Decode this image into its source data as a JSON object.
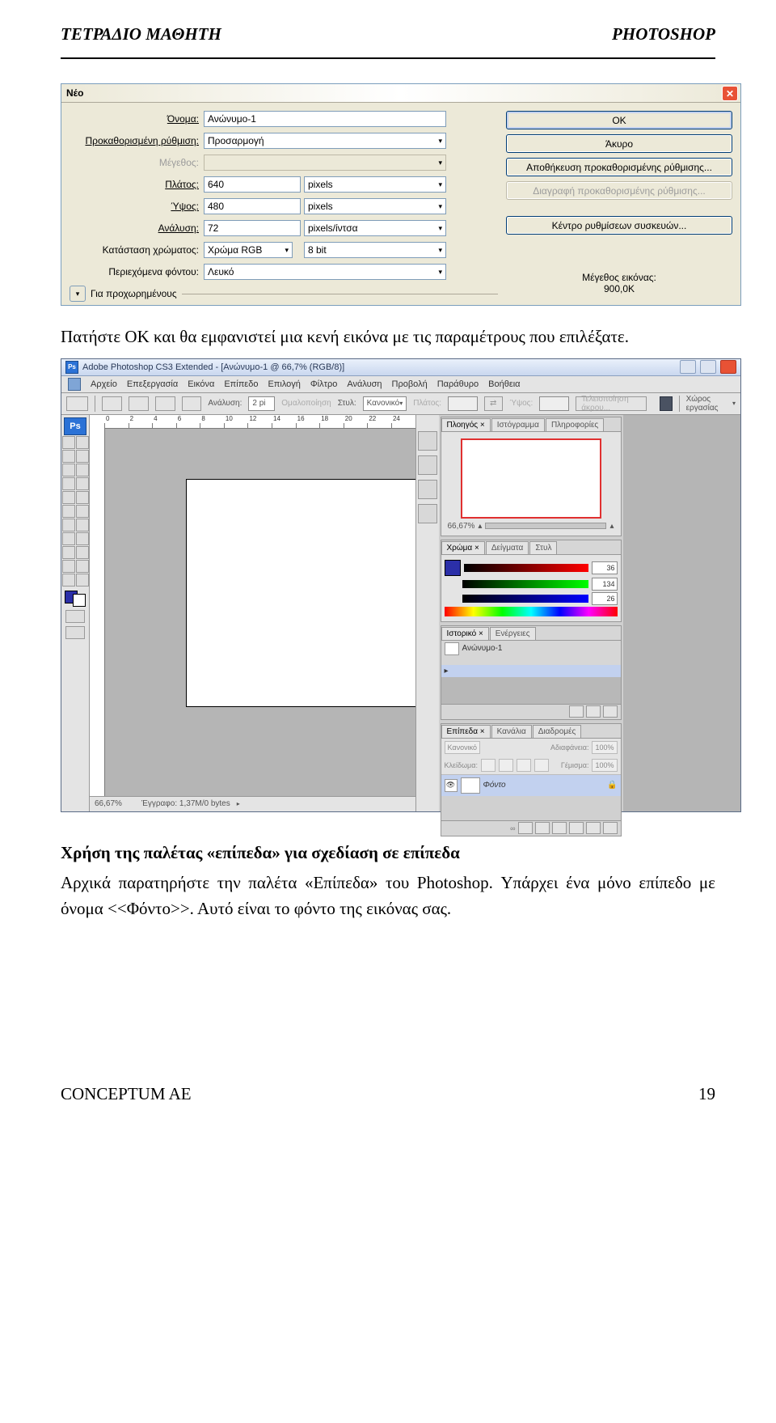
{
  "page_header": {
    "left": "ΤΕΤΡΑΔΙΟ ΜΑΘΗΤΗ",
    "right": "PHOTOSHOP"
  },
  "dialog1": {
    "title": "Νέο",
    "labels": {
      "name": "Όνομα:",
      "preset": "Προκαθορισμένη ρύθμιση:",
      "size": "Μέγεθος:",
      "width": "Πλάτος:",
      "height": "Ύψος:",
      "resolution": "Ανάλυση:",
      "colormode": "Κατάσταση χρώματος:",
      "bgcontents": "Περιεχόμενα φόντου:",
      "advanced": "Για προχωρημένους"
    },
    "values": {
      "name": "Ανώνυμο-1",
      "preset": "Προσαρμογή",
      "width": "640",
      "width_unit": "pixels",
      "height": "480",
      "height_unit": "pixels",
      "resolution": "72",
      "resolution_unit": "pixels/ίντσα",
      "colormode": "Χρώμα RGB",
      "depth": "8 bit",
      "bg": "Λευκό"
    },
    "buttons": {
      "ok": "OK",
      "cancel": "Άκυρο",
      "save_preset": "Αποθήκευση προκαθορισμένης ρύθμισης...",
      "delete_preset": "Διαγραφή προκαθορισμένης ρύθμισης...",
      "device_central": "Κέντρο ρυθμίσεων συσκευών..."
    },
    "imagesize_label": "Μέγεθος εικόνας:",
    "imagesize_value": "900,0K"
  },
  "paragraph1": "Πατήστε OK και θα εμφανιστεί μια κενή εικόνα με τις παραμέτρους που επιλέξατε.",
  "ps": {
    "title": "Adobe Photoshop CS3 Extended - [Ανώνυμο-1 @ 66,7% (RGB/8)]",
    "menubar": [
      "Αρχείο",
      "Επεξεργασία",
      "Εικόνα",
      "Επίπεδο",
      "Επιλογή",
      "Φίλτρο",
      "Ανάλυση",
      "Προβολή",
      "Παράθυρο",
      "Βοήθεια"
    ],
    "options": {
      "reslabel": "Ανάλυση:",
      "res": "2 pi",
      "aa": "Ομαλοποίηση",
      "style_label": "Στυλ:",
      "style": "Κανονικό",
      "width_label": "Πλάτος:",
      "height_label": "Ύψος:",
      "refine": "Τελειοποίηση άκρου...",
      "workspace": "Χώρος εργασίας"
    },
    "ruler_ticks": [
      "0",
      "2",
      "4",
      "6",
      "8",
      "10",
      "12",
      "14",
      "16",
      "18",
      "20",
      "22",
      "24"
    ],
    "status_zoom": "66,67%",
    "status_doc": "Έγγραφο: 1,37M/0 bytes",
    "navigator": {
      "tabs": [
        "Πλοηγός ×",
        "Ιστόγραμμα",
        "Πληροφορίες"
      ],
      "zoom": "66,67%"
    },
    "color": {
      "tabs": [
        "Χρώμα ×",
        "Δείγματα",
        "Στυλ"
      ],
      "r": "36",
      "g": "134",
      "b": "26"
    },
    "history": {
      "tabs": [
        "Ιστορικό ×",
        "Ενέργειες"
      ],
      "item": "Ανώνυμο-1"
    },
    "layers": {
      "tabs": [
        "Επίπεδα ×",
        "Κανάλια",
        "Διαδρομές"
      ],
      "mode": "Κανονικό",
      "opacity_label": "Αδιαφάνεια:",
      "opacity": "100%",
      "lock_label": "Κλείδωμα:",
      "fill_label": "Γέμισμα:",
      "fill": "100%",
      "layer_name": "Φόντο"
    }
  },
  "section_title": "Χρήση της παλέτας «επίπεδα» για σχεδίαση σε επίπεδα",
  "paragraph2": "Αρχικά παρατηρήστε την παλέτα «Επίπεδα» του Photoshop. Υπάρχει ένα μόνο επίπεδο με όνομα <<Φόντο>>. Αυτό είναι το φόντο της εικόνας σας.",
  "page_footer": {
    "left": "CONCEPTUM AE",
    "right": "19"
  }
}
